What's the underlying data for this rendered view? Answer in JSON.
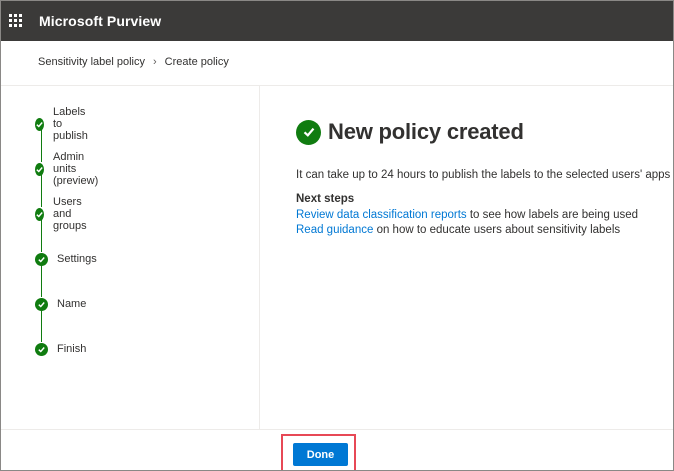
{
  "app": {
    "title": "Microsoft Purview"
  },
  "breadcrumb": {
    "items": [
      "Sensitivity label policy",
      "Create policy"
    ]
  },
  "steps": [
    {
      "label": "Labels to publish",
      "status": "complete"
    },
    {
      "label": "Admin units (preview)",
      "status": "complete"
    },
    {
      "label": "Users and groups",
      "status": "complete"
    },
    {
      "label": "Settings",
      "status": "complete"
    },
    {
      "label": "Name",
      "status": "complete"
    },
    {
      "label": "Finish",
      "status": "complete"
    }
  ],
  "main": {
    "title": "New policy created",
    "description": "It can take up to 24 hours to publish the labels to the selected users' apps",
    "next_steps_heading": "Next steps",
    "next_steps": [
      {
        "link": "Review data classification reports",
        "text": " to see how labels are being used"
      },
      {
        "link": "Read guidance",
        "text": " on how to educate users about sensitivity labels"
      }
    ]
  },
  "footer": {
    "done_label": "Done"
  },
  "colors": {
    "topbar": "#3b3a39",
    "success": "#107c10",
    "link": "#0078d4",
    "primary": "#0078d4",
    "highlight": "#e74856"
  },
  "icons": {
    "app_launcher": "waffle-icon",
    "step_status": "checkmark-circle-icon",
    "success": "checkmark-circle-icon",
    "breadcrumb_separator": "chevron-right-icon"
  }
}
